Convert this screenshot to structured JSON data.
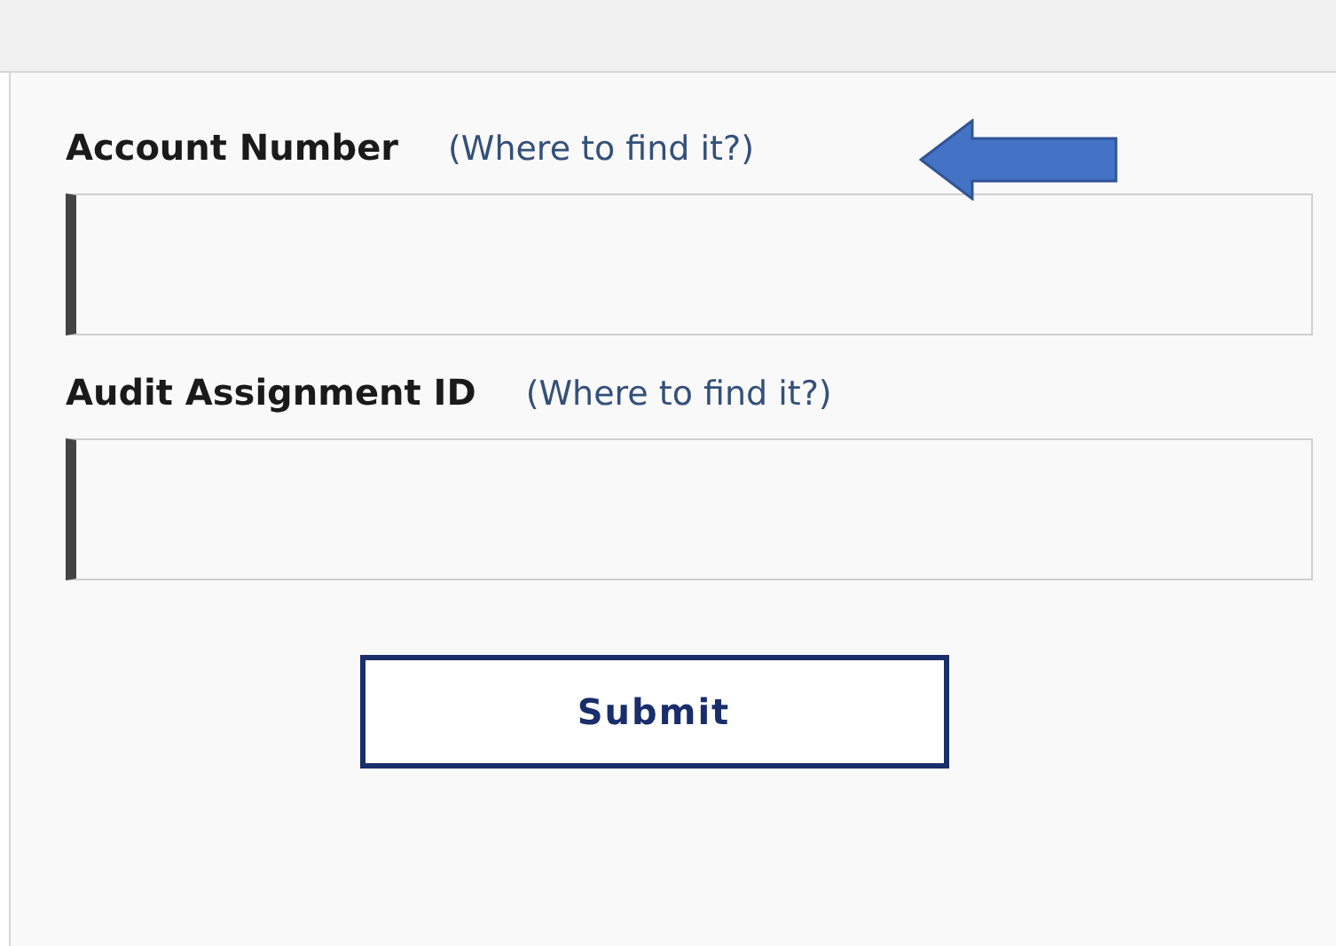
{
  "fields": [
    {
      "label": "Account Number",
      "help_link": "(Where to find it?)",
      "annotated": true
    },
    {
      "label": "Audit Assignment ID",
      "help_link": "(Where to find it?)",
      "annotated": false
    }
  ],
  "submit_button": "Submit"
}
